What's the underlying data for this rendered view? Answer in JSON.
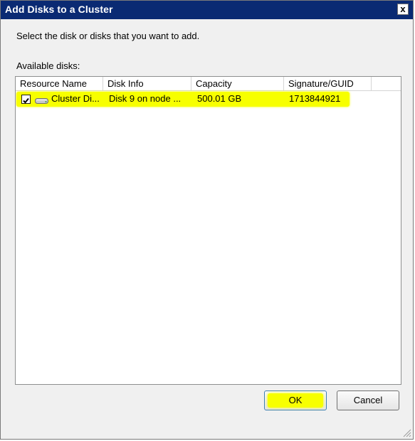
{
  "window": {
    "title": "Add Disks to a Cluster",
    "close_label": "x"
  },
  "instruction": "Select the disk or disks that you want to add.",
  "available_label": "Available disks:",
  "columns": [
    "Resource Name",
    "Disk Info",
    "Capacity",
    "Signature/GUID"
  ],
  "rows": [
    {
      "checked": true,
      "icon": "disk-icon",
      "resource_name": "Cluster Di...",
      "disk_info": "Disk 9 on node ...",
      "capacity": "500.01 GB",
      "signature": "1713844921"
    }
  ],
  "buttons": {
    "ok": "OK",
    "cancel": "Cancel"
  },
  "colors": {
    "titlebar": "#0a2a73",
    "highlight": "#f7ff00",
    "dialog_bg": "#f0f0f0"
  }
}
